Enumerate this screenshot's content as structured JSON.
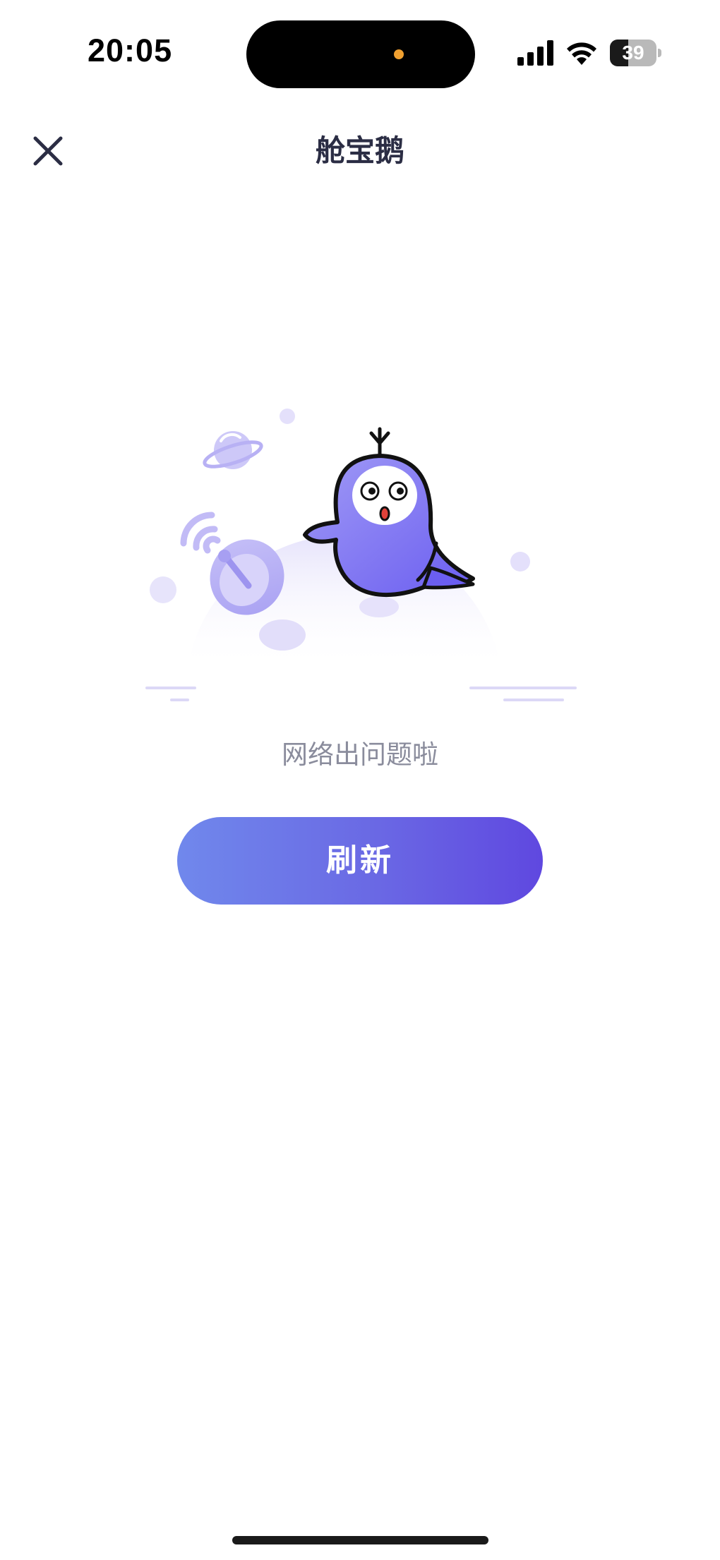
{
  "status_bar": {
    "time": "20:05",
    "battery_level": "39",
    "battery_fraction": 0.39
  },
  "nav": {
    "title": "舱宝鹅",
    "close_icon": "close-icon"
  },
  "error": {
    "message": "网络出问题啦"
  },
  "actions": {
    "refresh_label": "刷新"
  },
  "colors": {
    "accent_start": "#7088ec",
    "accent_end": "#5f48e0",
    "title": "#2b2d44",
    "muted_text": "#8a8c9c"
  }
}
